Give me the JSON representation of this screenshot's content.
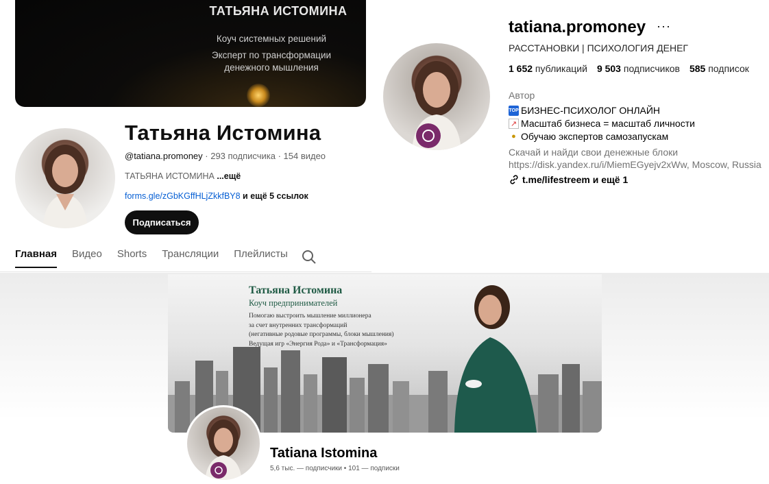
{
  "youtube": {
    "banner": {
      "title": "ТАТЬЯНА ИСТОМИНА",
      "line1": "Коуч системных решений",
      "line2": "Эксперт по трансформации",
      "line3": "денежного мышления"
    },
    "channel_name": "Татьяна Истомина",
    "handle": "@tatiana.promoney",
    "stats": " · 293 подписчика · 154 видео",
    "description": "ТАТЬЯНА ИСТОМИНА ",
    "description_more": "...ещё",
    "link": "forms.gle/zGbKGffHLjZkkfBY8",
    "links_more": " и ещё 5 ссылок",
    "subscribe_label": "Подписаться",
    "tabs": [
      {
        "label": "Главная"
      },
      {
        "label": "Видео"
      },
      {
        "label": "Shorts"
      },
      {
        "label": "Трансляции"
      },
      {
        "label": "Плейлисты"
      }
    ]
  },
  "instagram": {
    "username": "tatiana.promoney",
    "more": "···",
    "category": "РАССТАНОВКИ | ПСИХОЛОГИЯ ДЕНЕГ",
    "stats": [
      {
        "value": "1 652",
        "label": " публикаций"
      },
      {
        "value": "9 503",
        "label": " подписчиков"
      },
      {
        "value": "585",
        "label": " подписок"
      }
    ],
    "role": "Автор",
    "bio": [
      {
        "icon": "top-badge-icon",
        "text": "БИЗНЕС-ПСИХОЛОГ ОНЛАЙН"
      },
      {
        "icon": "chart-increasing-icon",
        "text": "Масштаб бизнеса = масштаб личности"
      },
      {
        "icon": "medal-icon",
        "text": "Обучаю экспертов самозапускам"
      }
    ],
    "extra1": "Скачай и найди свои денежные блоки",
    "extra2": "https://disk.yandex.ru/i/MiemEGyejv2xWw, Moscow, Russia",
    "link": "t.me/lifestreem и ещё 1"
  },
  "vk": {
    "banner": {
      "title": "Татьяна Истомина",
      "subtitle": "Коуч предпринимателей",
      "text": [
        "Помогаю выстроить мышление миллионера",
        "за счет внутренних трансформаций",
        "(негативные родовые программы, блоки мышления)",
        "Ведущая игр «Энергия Рода» и «Трансформация»"
      ]
    },
    "name": "Tatiana Istomina",
    "meta": "5,6 тыс. — подписчики • 101 — подписки"
  },
  "colors": {
    "yt_link": "#065fd4",
    "vk_title": "#1f5a44",
    "ig_badge": "#7a2a6a"
  }
}
